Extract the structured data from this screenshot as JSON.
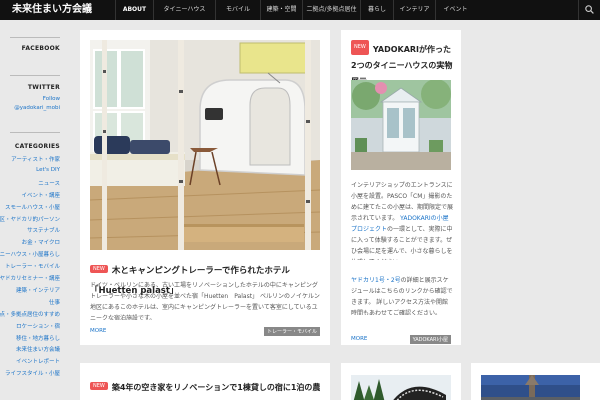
{
  "header": {
    "brand": "未来住まい方会議",
    "nav": [
      {
        "label": "ABOUT",
        "width": 38,
        "active": true
      },
      {
        "label": "タイニーハウス"
      },
      {
        "label": "モバイル"
      },
      {
        "label": "建築・空間"
      },
      {
        "label": "二拠点/多拠点居住"
      },
      {
        "label": "暮らし"
      },
      {
        "label": "インテリア"
      },
      {
        "label": "イベント"
      }
    ]
  },
  "sidebar": {
    "facebook": "FACEBOOK",
    "twitter": "TWITTER",
    "follow": "Follow",
    "handle": "@yadokari_mobi",
    "categories": "CATEGORIES",
    "links": [
      "アーティスト・作家",
      "Let's DIY",
      "ニュース",
      "イベント・講座",
      "スモールハウス・小屋",
      "23区・ヤドカリ的パーソン",
      "サステナブル",
      "お金・マイクロ",
      "タイニーハウス・小屋暮らし",
      "トレーラー・モバイル",
      "ヤドカリセミナー・講座",
      "建築・インテリア",
      "仕事",
      "二拠点・多拠点居住のすすめ",
      "ロケーション・宿",
      "移住・地方暮らし",
      "未来住まい方会議",
      "イベントレポート",
      "ライフスタイル・小屋"
    ]
  },
  "posts": {
    "main": {
      "badge": "NEW",
      "title": "木とキャンピングトレーラーで作られたホテル「Huetten palast」",
      "excerpt": "ドイツ・ベルリンにある、古い工場をリノベーションしたホテルの中にキャンピングトレーラーや小さな木の小屋を並べた宿「Huetten　Palast」 ベルリンのノイケルン地区にあるこのホテルは、室内にキャンピングトレーラーを置いて客室にしているユニークな宿泊施設です。",
      "more": "MORE",
      "tag": "トレーラー・モバイル"
    },
    "side": {
      "badge": "NEW",
      "title": "YADOKARIが作った2つのタイニーハウスの実物展示",
      "excerpt1": "インテリアショップのエントランスに小屋を設置。PASCO「CM」撮影のために建てたこの小屋は、期間限定で展示されています。 ",
      "link1": "YADOKARIの小屋プロジェクト",
      "excerpt1b": "の一環として、実際に中に入って体験することができます。ぜひ会場に足を運んで、小さな暮らしを体感してください。",
      "link2": "ヤドカリ1号・2号",
      "excerpt2": "の詳細と展示スケジュールはこちらのリンクから確認できます。 詳しいアクセス方法や開館時間もあわせてご確認ください。",
      "more": "MORE",
      "tag": "YADOKARI小屋"
    },
    "bottom": {
      "badge": "NEW",
      "title": "築4年の空き家をリノベーションで1棟貸しの宿に1泊の農家民泊体験"
    }
  },
  "colors": {
    "accent": "#e55555",
    "link": "#1a73c8",
    "nav_bg": "#111111"
  }
}
